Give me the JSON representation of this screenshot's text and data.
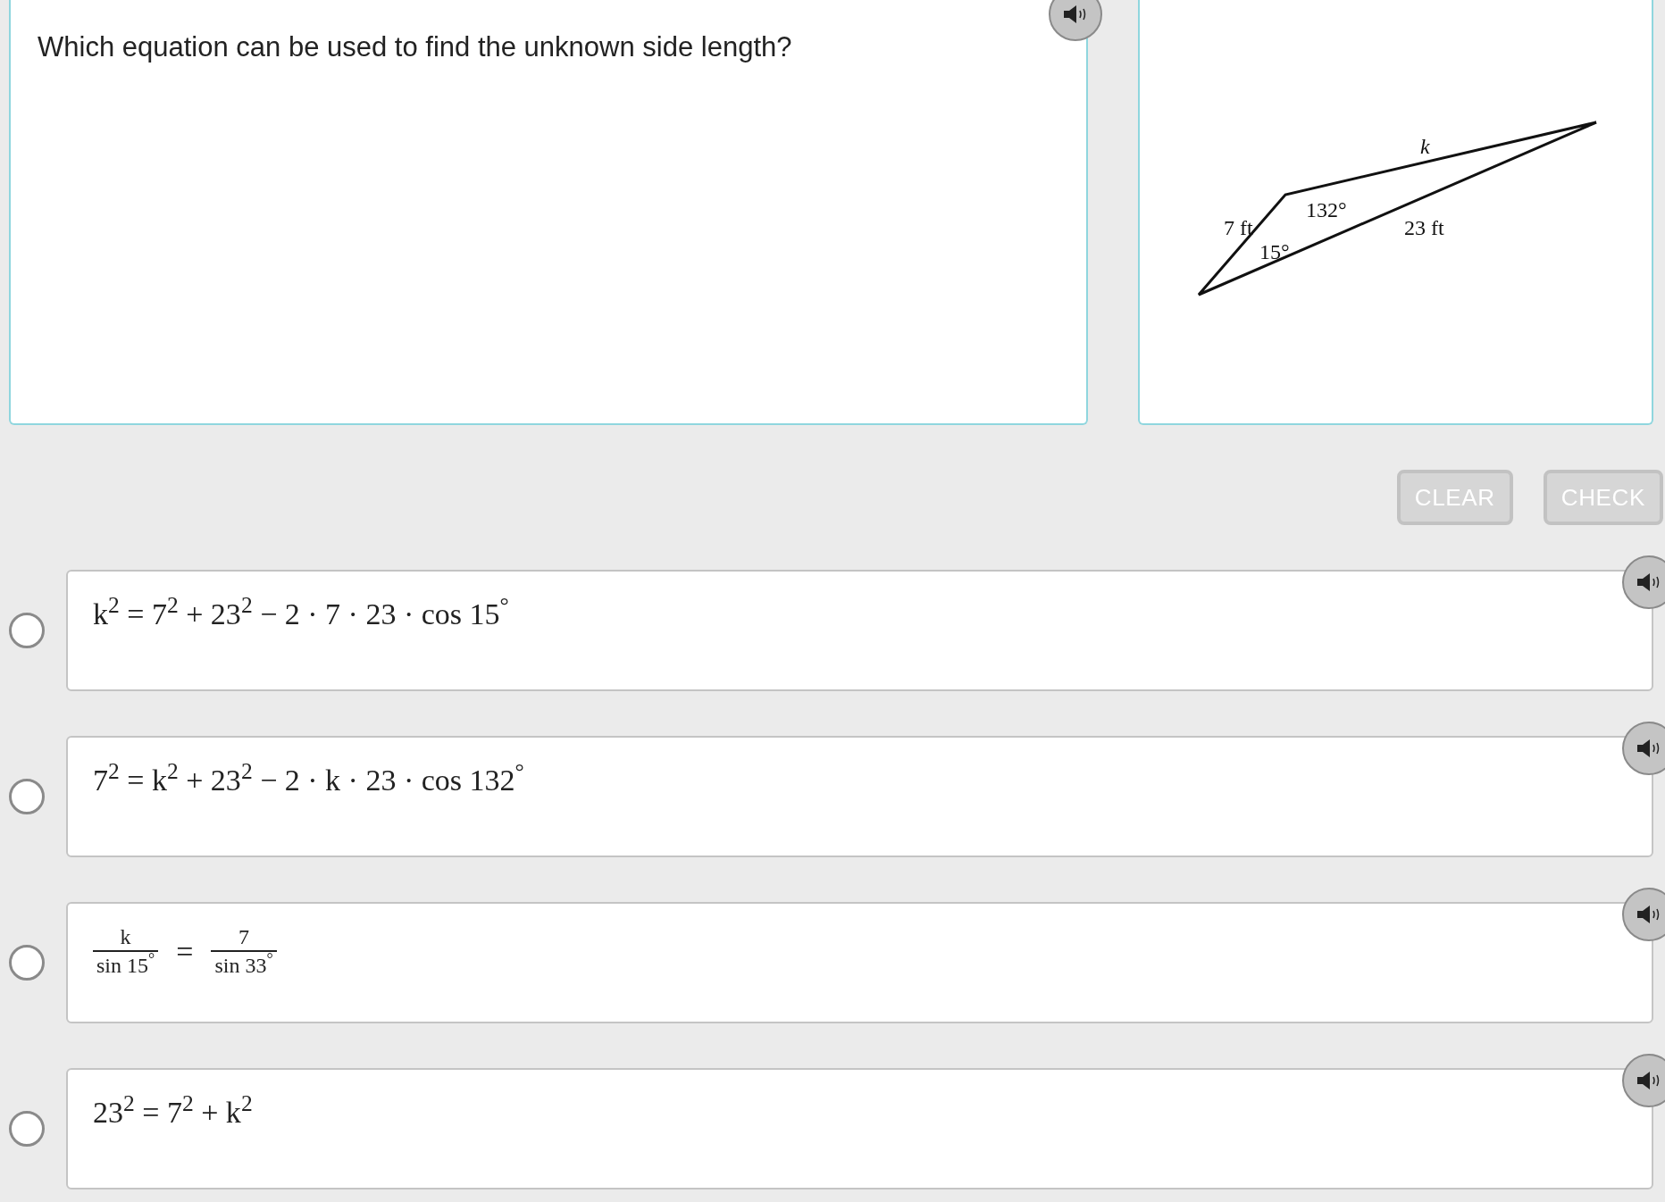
{
  "question": {
    "text": "Which equation can be used to find the unknown side length?"
  },
  "diagram": {
    "labels": [
      {
        "text": "k"
      },
      {
        "text": "132°"
      },
      {
        "text": "7 ft"
      },
      {
        "text": "15°"
      },
      {
        "text": "23 ft"
      }
    ]
  },
  "buttons": [
    {
      "label": "CLEAR",
      "disabled": true
    },
    {
      "label": "CHECK",
      "disabled": true
    }
  ],
  "options": [
    {
      "kind": "equation",
      "selected": false,
      "text": "k$^{2}$ = 7$^{2}$ + 23$^{2}$ − 2 · 7 · 23 · cos 15$^{°}$"
    },
    {
      "kind": "equation",
      "selected": false,
      "text": "7$^{2}$ = k$^{2}$ + 23$^{2}$ − 2 · k · 23 · cos 132$^{°}$"
    },
    {
      "kind": "fraction",
      "selected": false,
      "left": {
        "numerator": "k",
        "denominator": "sin 15$^{°}$"
      },
      "operator": "=",
      "right": {
        "numerator": "7",
        "denominator": "sin 33$^{°}$"
      }
    },
    {
      "kind": "equation",
      "selected": false,
      "text": "23$^{2}$ = 7$^{2}$ + k$^{2}$"
    }
  ]
}
